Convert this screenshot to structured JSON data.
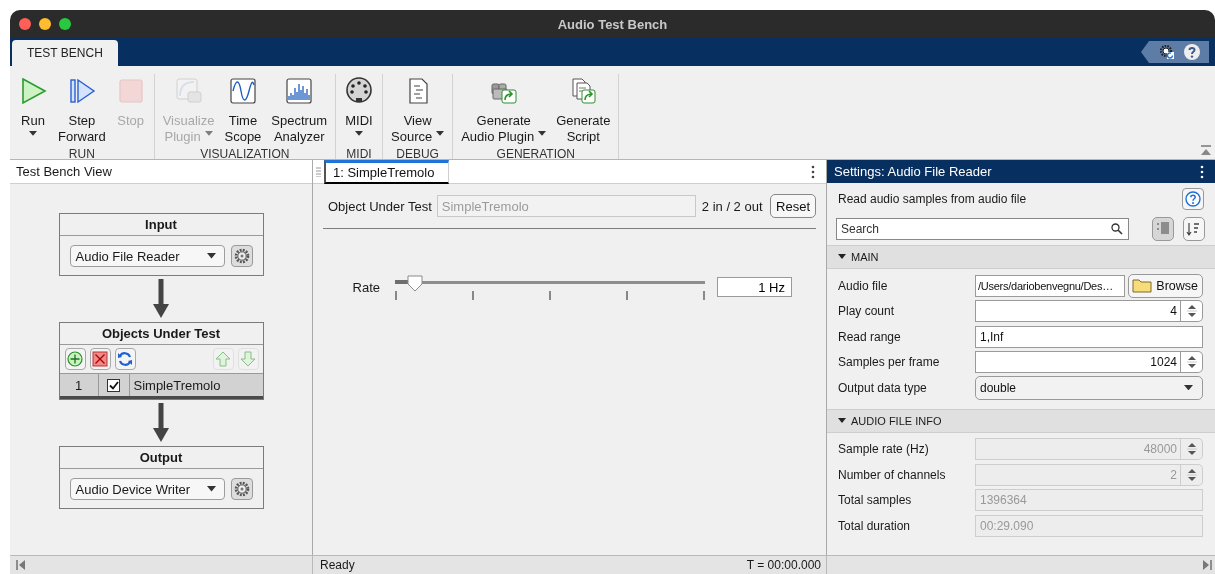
{
  "window": {
    "title": "Audio Test Bench"
  },
  "toolstrip": {
    "tabs": [
      {
        "label": "TEST BENCH",
        "selected": true
      }
    ]
  },
  "ribbon": [
    {
      "label": "RUN",
      "buttons": [
        {
          "lines": [
            "Run"
          ],
          "dropdown": true,
          "disabled": false
        },
        {
          "lines": [
            "Step",
            "Forward"
          ],
          "dropdown": false,
          "disabled": false
        },
        {
          "lines": [
            "Stop"
          ],
          "dropdown": false,
          "disabled": true
        }
      ]
    },
    {
      "label": "VISUALIZATION",
      "buttons": [
        {
          "lines": [
            "Visualize",
            "Plugin"
          ],
          "dropdown": true,
          "disabled": true
        },
        {
          "lines": [
            "Time",
            "Scope"
          ],
          "dropdown": false,
          "disabled": false
        },
        {
          "lines": [
            "Spectrum",
            "Analyzer"
          ],
          "dropdown": false,
          "disabled": false
        }
      ]
    },
    {
      "label": "MIDI",
      "buttons": [
        {
          "lines": [
            "MIDI"
          ],
          "dropdown": true,
          "disabled": false
        }
      ]
    },
    {
      "label": "DEBUG",
      "buttons": [
        {
          "lines": [
            "View",
            "Source"
          ],
          "dropdown": true,
          "disabled": false
        }
      ]
    },
    {
      "label": "GENERATION",
      "buttons": [
        {
          "lines": [
            "Generate",
            "Audio Plugin"
          ],
          "dropdown": true,
          "disabled": false
        },
        {
          "lines": [
            "Generate",
            "Script"
          ],
          "dropdown": false,
          "disabled": false
        }
      ]
    }
  ],
  "test_bench_view": {
    "title": "Test Bench View",
    "input": {
      "title": "Input",
      "source": "Audio File Reader"
    },
    "objects": {
      "title": "Objects Under Test",
      "tools": [
        {
          "disabled": false
        },
        {
          "disabled": false
        },
        {
          "disabled": false
        },
        {
          "disabled": true
        },
        {
          "disabled": true
        }
      ],
      "rows": [
        {
          "index": "1",
          "checked": true,
          "name": "SimpleTremolo",
          "selected": true
        }
      ]
    },
    "output": {
      "title": "Output",
      "sink": "Audio Device Writer"
    }
  },
  "document_tabs": [
    {
      "label": "1: SimpleTremolo",
      "selected": true
    }
  ],
  "plugin": {
    "object_label": "Object Under Test",
    "object_value": "SimpleTremolo",
    "io": "2 in / 2 out",
    "reset": "Reset",
    "parameters": [
      {
        "name": "Rate",
        "level": 0.065,
        "value": "1 Hz"
      }
    ]
  },
  "settings": {
    "title": "Settings: Audio File Reader",
    "description": "Read audio samples from audio file",
    "search": {
      "placeholder": "Search"
    },
    "view_buttons": [
      {
        "selected": true
      },
      {
        "selected": false
      }
    ],
    "sections": [
      {
        "title": "MAIN",
        "expanded": true,
        "fields": [
          {
            "kind": "file",
            "label": "Audio file",
            "value": "/Users/dariobenvegnu/Des…",
            "button": "Browse",
            "disabled": false
          },
          {
            "kind": "spinner",
            "label": "Play count",
            "value": "4",
            "disabled": false
          },
          {
            "kind": "text",
            "label": "Read range",
            "value": "1,Inf",
            "disabled": false
          },
          {
            "kind": "spinner",
            "label": "Samples per frame",
            "value": "1024",
            "disabled": false
          },
          {
            "kind": "dropdown",
            "label": "Output data type",
            "value": "double",
            "disabled": false
          }
        ]
      },
      {
        "title": "AUDIO FILE INFO",
        "expanded": true,
        "fields": [
          {
            "kind": "spinner",
            "label": "Sample rate (Hz)",
            "value": "48000",
            "disabled": true
          },
          {
            "kind": "spinner",
            "label": "Number of channels",
            "value": "2",
            "disabled": true
          },
          {
            "kind": "text",
            "label": "Total samples",
            "value": "1396364",
            "disabled": true
          },
          {
            "kind": "text",
            "label": "Total duration",
            "value": "00:29.090",
            "disabled": true
          }
        ]
      }
    ]
  },
  "status_bar": {
    "message": "Ready",
    "time": "T = 00:00.000"
  }
}
